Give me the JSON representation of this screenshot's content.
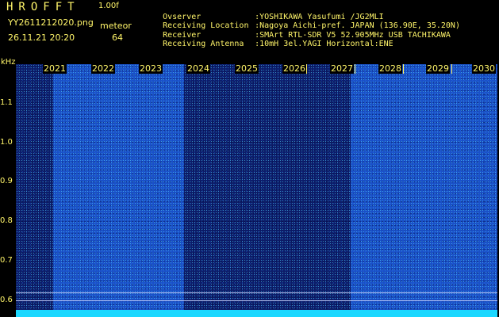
{
  "header": {
    "app_title": "HROFFT",
    "version": "1.00f",
    "filename": "YY2611212020.png",
    "datetime": "26.11.21 20:20",
    "meteor_label": "meteor",
    "meteor_count": "64"
  },
  "info": {
    "observer_label": "Ovserver",
    "observer_value": ":YOSHIKAWA Yasufumi /JG2MLI",
    "location_label": "Receiving Location",
    "location_value": ":Nagoya Aichi-pref. JAPAN (136.90E, 35.20N)",
    "receiver_label": "Receiver",
    "receiver_value": ":SMArt RTL-SDR V5 52.905MHz USB TACHIKAWA",
    "antenna_label": "Receiving Antenna",
    "antenna_value": ":10mH 3el.YAGI Horizontal:ENE"
  },
  "y_axis": {
    "unit": "kHz",
    "ticks": [
      "1.1",
      "1.0",
      "0.9",
      "0.8",
      "0.7",
      "0.6"
    ]
  },
  "x_axis": {
    "minute_labels": [
      "2021",
      "2022",
      "2023",
      "2024",
      "2025",
      "2026",
      "2027",
      "2028",
      "2029",
      "2030"
    ]
  },
  "colors": {
    "label_yellow": "#fff56a",
    "noise_bright": "#1a50c8",
    "noise_dark": "#0c1c6a",
    "baseline_cyan": "#1bd8ff"
  }
}
